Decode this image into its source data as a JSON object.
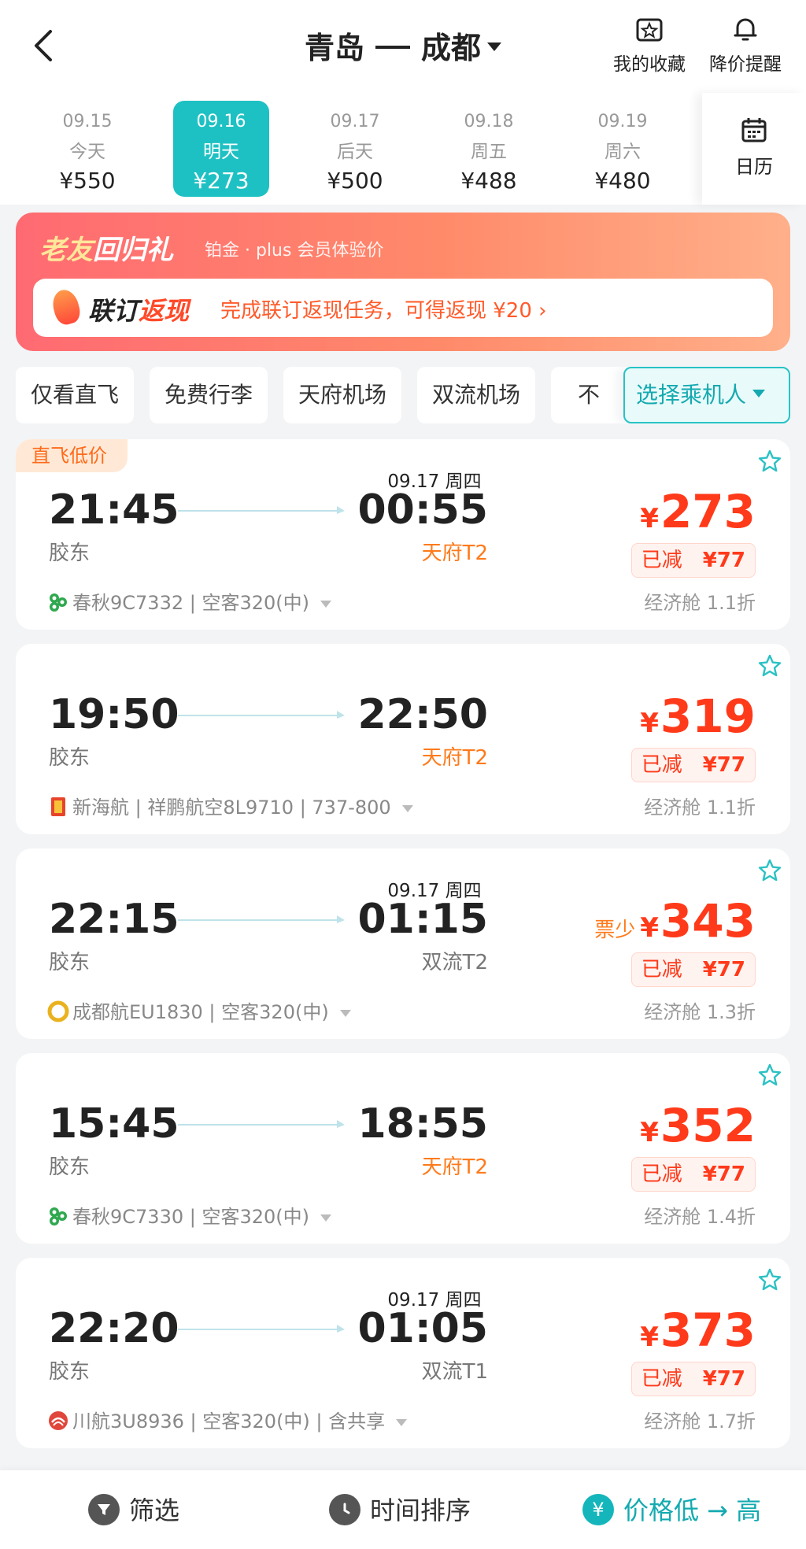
{
  "header": {
    "origin": "青岛",
    "destination": "成都",
    "favorites_label": "我的收藏",
    "price_alert_label": "降价提醒"
  },
  "dates": [
    {
      "date": "09.15",
      "day": "今天",
      "price": "¥550",
      "active": false
    },
    {
      "date": "09.16",
      "day": "明天",
      "price": "¥273",
      "active": true
    },
    {
      "date": "09.17",
      "day": "后天",
      "price": "¥500",
      "active": false
    },
    {
      "date": "09.18",
      "day": "周五",
      "price": "¥488",
      "active": false
    },
    {
      "date": "09.19",
      "day": "周六",
      "price": "¥480",
      "active": false
    }
  ],
  "calendar_label": "日历",
  "promo": {
    "title_a": "老友",
    "title_b": "回归礼",
    "subtitle": "铂金 · plus 会员体验价",
    "label_a": "联订",
    "label_b": "返现",
    "text": "完成联订返现任务，可得返现 ¥20 ›"
  },
  "filters": [
    "仅看直飞",
    "免费行李",
    "天府机场",
    "双流机场",
    "不"
  ],
  "passenger_button": "选择乘机人",
  "flights": [
    {
      "tag": "直飞低价",
      "arr_date": "09.17 周四",
      "dep_time": "21:45",
      "arr_time": "00:55",
      "dep_airport": "胶东",
      "arr_airport": "天府T2",
      "airline": "春秋9C7332 | 空客320(中)",
      "price": "273",
      "few": "",
      "discount_label": "已减",
      "discount": "¥77",
      "cabin": "经济舱 1.1折"
    },
    {
      "tag": "",
      "arr_date": "",
      "dep_time": "19:50",
      "arr_time": "22:50",
      "dep_airport": "胶东",
      "arr_airport": "天府T2",
      "airline": "新海航 | 祥鹏航空8L9710 | 737-800",
      "price": "319",
      "few": "",
      "discount_label": "已减",
      "discount": "¥77",
      "cabin": "经济舱 1.1折"
    },
    {
      "tag": "",
      "arr_date": "09.17 周四",
      "dep_time": "22:15",
      "arr_time": "01:15",
      "dep_airport": "胶东",
      "arr_airport": "双流T2",
      "airline": "成都航EU1830 | 空客320(中)",
      "price": "343",
      "few": "票少",
      "discount_label": "已减",
      "discount": "¥77",
      "cabin": "经济舱 1.3折"
    },
    {
      "tag": "",
      "arr_date": "",
      "dep_time": "15:45",
      "arr_time": "18:55",
      "dep_airport": "胶东",
      "arr_airport": "天府T2",
      "airline": "春秋9C7330 | 空客320(中)",
      "price": "352",
      "few": "",
      "discount_label": "已减",
      "discount": "¥77",
      "cabin": "经济舱 1.4折"
    },
    {
      "tag": "",
      "arr_date": "09.17 周四",
      "dep_time": "22:20",
      "arr_time": "01:05",
      "dep_airport": "胶东",
      "arr_airport": "双流T1",
      "airline": "川航3U8936 | 空客320(中) | 含共享",
      "price": "373",
      "few": "",
      "discount_label": "已减",
      "discount": "¥77",
      "cabin": "经济舱 1.7折"
    }
  ],
  "bottom": {
    "filter": "筛选",
    "time_sort": "时间排序",
    "price_sort": "价格低 → 高"
  },
  "colors": {
    "accent": "#1ec1c3",
    "price": "#ff3a1a",
    "terminal": "#ff7a1a"
  }
}
